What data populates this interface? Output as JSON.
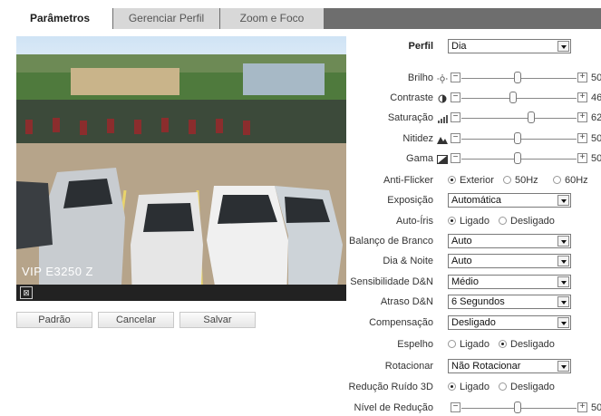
{
  "tabs": [
    {
      "label": "Parâmetros",
      "active": true
    },
    {
      "label": "Gerenciar Perfil",
      "active": false
    },
    {
      "label": "Zoom e Foco",
      "active": false
    }
  ],
  "video": {
    "camera_label": "VIP E3250 Z"
  },
  "buttons": {
    "default": "Padrão",
    "cancel": "Cancelar",
    "save": "Salvar"
  },
  "settings": {
    "perfil": {
      "label": "Perfil",
      "value": "Dia"
    },
    "brilho": {
      "label": "Brilho",
      "value": 50
    },
    "contraste": {
      "label": "Contraste",
      "value": 46
    },
    "saturacao": {
      "label": "Saturação",
      "value": 62
    },
    "nitidez": {
      "label": "Nitidez",
      "value": 50
    },
    "gama": {
      "label": "Gama",
      "value": 50
    },
    "anti_flicker": {
      "label": "Anti-Flicker",
      "options": [
        "Exterior",
        "50Hz",
        "60Hz"
      ],
      "selected": "Exterior"
    },
    "exposicao": {
      "label": "Exposição",
      "value": "Automática"
    },
    "auto_iris": {
      "label": "Auto-Íris",
      "options": [
        "Ligado",
        "Desligado"
      ],
      "selected": "Ligado"
    },
    "balanco_branco": {
      "label": "Balanço de Branco",
      "value": "Auto"
    },
    "dia_noite": {
      "label": "Dia & Noite",
      "value": "Auto"
    },
    "sensibilidade": {
      "label": "Sensibilidade D&N",
      "value": "Médio"
    },
    "atraso": {
      "label": "Atraso D&N",
      "value": "6 Segundos"
    },
    "compensacao": {
      "label": "Compensação",
      "value": "Desligado"
    },
    "espelho": {
      "label": "Espelho",
      "options": [
        "Ligado",
        "Desligado"
      ],
      "selected": "Desligado"
    },
    "rotacionar": {
      "label": "Rotacionar",
      "value": "Não Rotacionar"
    },
    "reducao_ruido": {
      "label": "Redução Ruído 3D",
      "options": [
        "Ligado",
        "Desligado"
      ],
      "selected": "Ligado"
    },
    "nivel_reducao": {
      "label": "Nível de Redução",
      "value": 50
    }
  },
  "colors": {
    "tabbar": "#6e6e6e",
    "accent": "#1d1d1d"
  }
}
